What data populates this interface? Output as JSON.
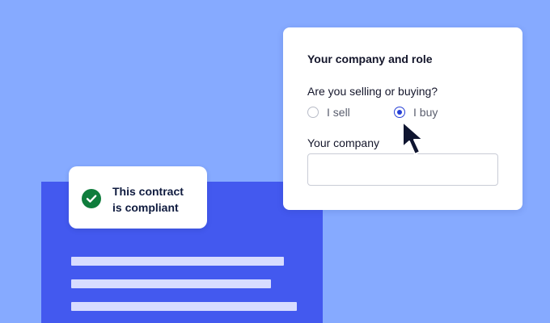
{
  "badge": {
    "line1": "This contract",
    "line2": "is compliant",
    "icon": "check-circle-icon",
    "icon_color": "#0f7d3c"
  },
  "form": {
    "title": "Your company and role",
    "question": "Are you selling or buying?",
    "options": [
      {
        "label": "I sell",
        "selected": false
      },
      {
        "label": "I buy",
        "selected": true
      }
    ],
    "company_label": "Your company",
    "company_value": "",
    "accent_color": "#2740d6"
  },
  "colors": {
    "background": "#86aaff",
    "document": "#4359ef",
    "document_lines": "#d7dcff"
  },
  "cursor": {
    "icon": "mouse-pointer-icon"
  }
}
